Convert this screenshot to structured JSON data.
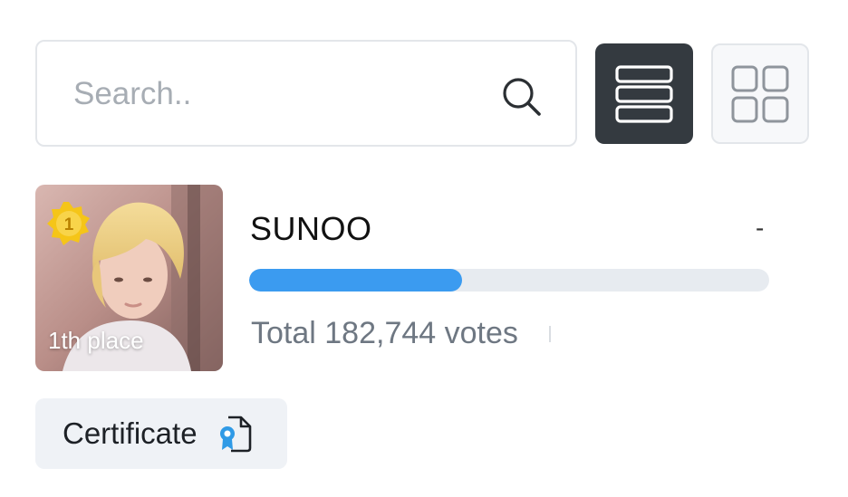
{
  "search": {
    "placeholder": "Search..",
    "icon": "search-icon"
  },
  "view_toggle": {
    "list_icon": "list-view-icon",
    "grid_icon": "grid-view-icon",
    "active": "list",
    "active_color": "#343a40"
  },
  "ranking": {
    "rank": "1",
    "place_label": "1th place",
    "name": "SUNOO",
    "change": "-",
    "votes_text": "Total 182,744 votes",
    "progress_percent": 41,
    "progress_color": "#3b9bf0",
    "medal_color": "#f5c518"
  },
  "certificate": {
    "label": "Certificate",
    "icon": "certificate-icon"
  }
}
